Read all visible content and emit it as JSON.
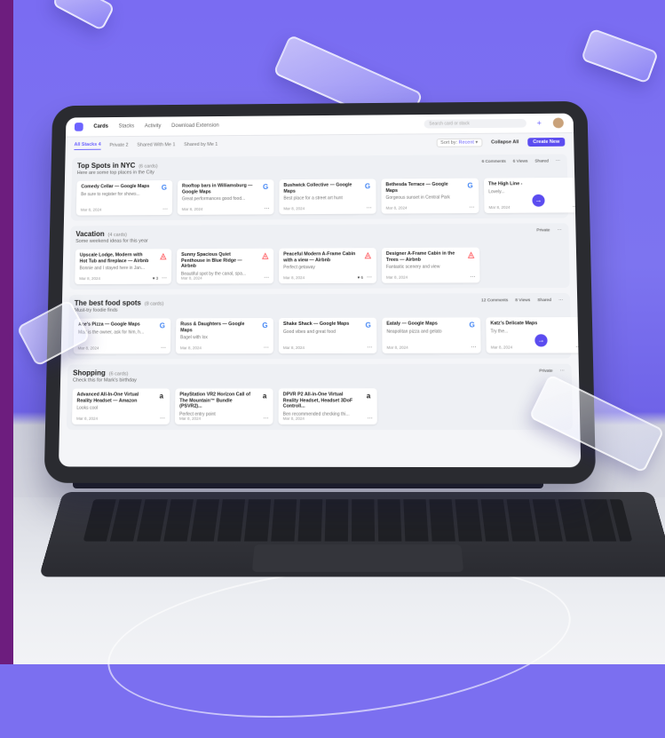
{
  "app": {
    "nav": [
      "Cards",
      "Stacks",
      "Activity",
      "Download Extension"
    ],
    "active_nav": "Cards",
    "search_placeholder": "Search card or stack"
  },
  "subbar": {
    "tabs": [
      "All Stacks 4",
      "Private 2",
      "Shared With Me 1",
      "Shared by Me 1"
    ],
    "sort_prefix": "Sort by:",
    "sort_value": "Recent",
    "collapse_label": "Collapse All",
    "create_label": "Create New"
  },
  "stacks": [
    {
      "title": "Top Spots in NYC",
      "count": "(6 cards)",
      "desc": "Here are some top places in the City",
      "meta": [
        "6 Comments",
        "6 Views",
        "Shared"
      ],
      "cards": [
        {
          "title": "Comedy Cellar — Google Maps",
          "desc": "Be sure to register for shows...",
          "date": "Mar 8, 2024",
          "icon": "G"
        },
        {
          "title": "Rooftop bars in Williamsburg — Google Maps",
          "desc": "Great performances good food...",
          "date": "Mar 8, 2024",
          "icon": "G"
        },
        {
          "title": "Bushwick Collective — Google Maps",
          "desc": "Best place for a street art hunt",
          "date": "Mar 8, 2024",
          "icon": "G"
        },
        {
          "title": "Bethesda Terrace — Google Maps",
          "desc": "Gorgeous sunset in Central Park",
          "date": "Mar 8, 2024",
          "icon": "G"
        },
        {
          "title": "The High Line -",
          "desc": "Lovely...",
          "date": "Mar 8, 2024",
          "icon": ""
        }
      ]
    },
    {
      "title": "Vacation",
      "count": "(4 cards)",
      "desc": "Some weekend ideas for this year",
      "meta": [
        "Private"
      ],
      "cards": [
        {
          "title": "Upscale Lodge, Modern with Hot Tub and fireplace — Airbnb",
          "desc": "Bonnie and I stayed here in Jan...",
          "date": "Mar 8, 2024",
          "icon": "A",
          "likes": "3"
        },
        {
          "title": "Sunny Spacious Quiet Penthouse in Blue Ridge — Airbnb",
          "desc": "Beautiful spot by the canal, spa...",
          "date": "Mar 8, 2024",
          "icon": "A"
        },
        {
          "title": "Peaceful Modern A-Frame Cabin with a view — Airbnb",
          "desc": "Perfect getaway",
          "date": "Mar 8, 2024",
          "icon": "A",
          "likes": "6"
        },
        {
          "title": "Designer A-Frame Cabin in the Trees — Airbnb",
          "desc": "Fantastic scenery and view",
          "date": "Mar 8, 2024",
          "icon": "A"
        }
      ]
    },
    {
      "title": "The best food spots",
      "count": "(8 cards)",
      "desc": "Must-try foodie finds",
      "meta": [
        "12 Comments",
        "8 Views",
        "Shared"
      ],
      "cards": [
        {
          "title": "Ace's Pizza — Google Maps",
          "desc": "Matt is the owner, ask for him, h...",
          "date": "Mar 8, 2024",
          "icon": "G"
        },
        {
          "title": "Russ & Daughters — Google Maps",
          "desc": "Bagel with lox",
          "date": "Mar 8, 2024",
          "icon": "G"
        },
        {
          "title": "Shake Shack — Google Maps",
          "desc": "Good vibes and great food",
          "date": "Mar 8, 2024",
          "icon": "G"
        },
        {
          "title": "Eataly — Google Maps",
          "desc": "Neapolitan pizza and gelato",
          "date": "Mar 8, 2024",
          "icon": "G"
        },
        {
          "title": "Katz's Delicate Maps",
          "desc": "Try the...",
          "date": "Mar 8, 2024",
          "icon": ""
        }
      ]
    },
    {
      "title": "Shopping",
      "count": "(6 cards)",
      "desc": "Check this for Mark's birthday",
      "meta": [
        "Private"
      ],
      "cards": [
        {
          "title": "Advanced All-In-One Virtual Reality Headset — Amazon",
          "desc": "Looks cool",
          "date": "Mar 8, 2024",
          "icon": "a"
        },
        {
          "title": "PlayStation VR2 Horizon Call of The Mountain™ Bundle (PSVR2)...",
          "desc": "Perfect entry point",
          "date": "Mar 8, 2024",
          "icon": "a"
        },
        {
          "title": "DPVR P2 All-in-One Virtual Reality Headset, Headset 3DoF Controll...",
          "desc": "Ben recommended checking thi...",
          "date": "Mar 8, 2024",
          "icon": "a"
        }
      ]
    }
  ]
}
